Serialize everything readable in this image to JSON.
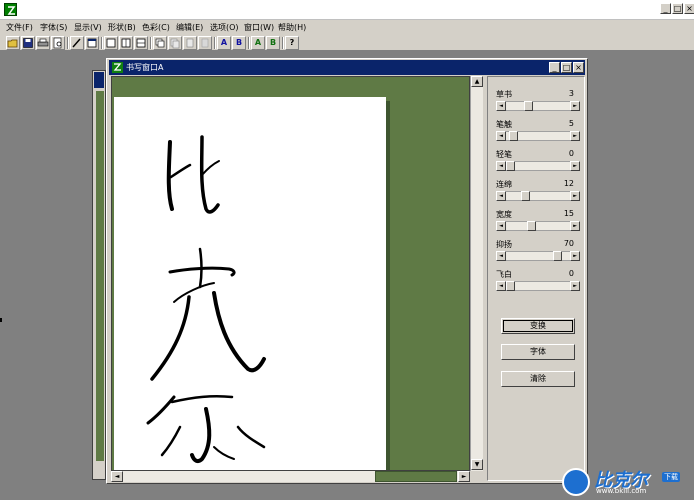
{
  "titlebar": {
    "minimize_label": "_",
    "maximize_label": "□",
    "close_label": "×"
  },
  "menu": [
    {
      "label": "文件(F)"
    },
    {
      "label": "字体(S)"
    },
    {
      "label": "显示(V)"
    },
    {
      "label": "形状(B)"
    },
    {
      "label": "色彩(C)"
    },
    {
      "label": "编辑(E)"
    },
    {
      "label": "选项(O)"
    },
    {
      "label": "窗口(W)"
    },
    {
      "label": "帮助(H)"
    }
  ],
  "toolbar": {
    "a_label": "A",
    "b_label": "B",
    "help_label": "?"
  },
  "child_window": {
    "title": "书写窗口A",
    "minimize_label": "_",
    "maximize_label": "□",
    "close_label": "×"
  },
  "controls": [
    {
      "label": "草书",
      "value": "3",
      "level": 0.3
    },
    {
      "label": "笔触",
      "value": "5",
      "level": 0.1
    },
    {
      "label": "轻笔",
      "value": "0",
      "level": 0.0
    },
    {
      "label": "连绵",
      "value": "12",
      "level": 0.3
    },
    {
      "label": "宽度",
      "value": "15",
      "level": 0.35
    },
    {
      "label": "抑扬",
      "value": "70",
      "level": 0.72
    },
    {
      "label": "飞白",
      "value": "0",
      "level": 0.0
    }
  ],
  "buttons": {
    "transform": "变换",
    "font": "字体",
    "clear": "清除"
  },
  "watermark": {
    "brand": "比克尔",
    "sub": "www.bkill.com",
    "badge": "下载"
  },
  "colors": {
    "canvas_bg": "#5f7a45",
    "title_active": "#0a246a",
    "face": "#d4d0c8",
    "desktop": "#808080"
  }
}
